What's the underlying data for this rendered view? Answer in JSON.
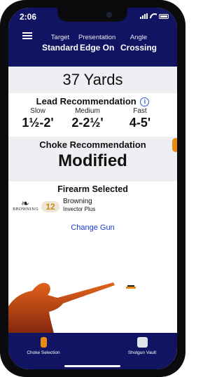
{
  "status": {
    "time": "2:06"
  },
  "header": {
    "target_label": "Target",
    "target_value": "Standard",
    "presentation_label": "Presentation",
    "presentation_value": "Edge On",
    "angle_label": "Angle",
    "angle_value": "Crossing"
  },
  "distance": {
    "text": "37 Yards"
  },
  "lead": {
    "title": "Lead Recommendation",
    "info_icon": "i",
    "slow_label": "Slow",
    "slow_value": "1½-2'",
    "medium_label": "Medium",
    "medium_value": "2-2½'",
    "fast_label": "Fast",
    "fast_value": "4-5'"
  },
  "choke": {
    "title": "Choke Recommendation",
    "value": "Modified"
  },
  "firearm": {
    "title": "Firearm Selected",
    "brand_logo_text": "BROWNING",
    "gauge": "12",
    "make": "Browning",
    "model": "Invector Plus",
    "change_label": "Change Gun"
  },
  "tabs": {
    "choke_label": "Choke Selection",
    "vault_label": "Shotgun Vault"
  },
  "colors": {
    "navy": "#111462",
    "accent_orange": "#e98a12",
    "link_blue": "#1a3ad6",
    "gauge_gold": "#c48a1e"
  },
  "icons": {
    "menu": "hamburger-icon",
    "info": "info-icon",
    "choke_tab": "choke-tube-icon",
    "vault_tab": "shotgun-vault-icon",
    "brand": "buck-mark-logo"
  }
}
